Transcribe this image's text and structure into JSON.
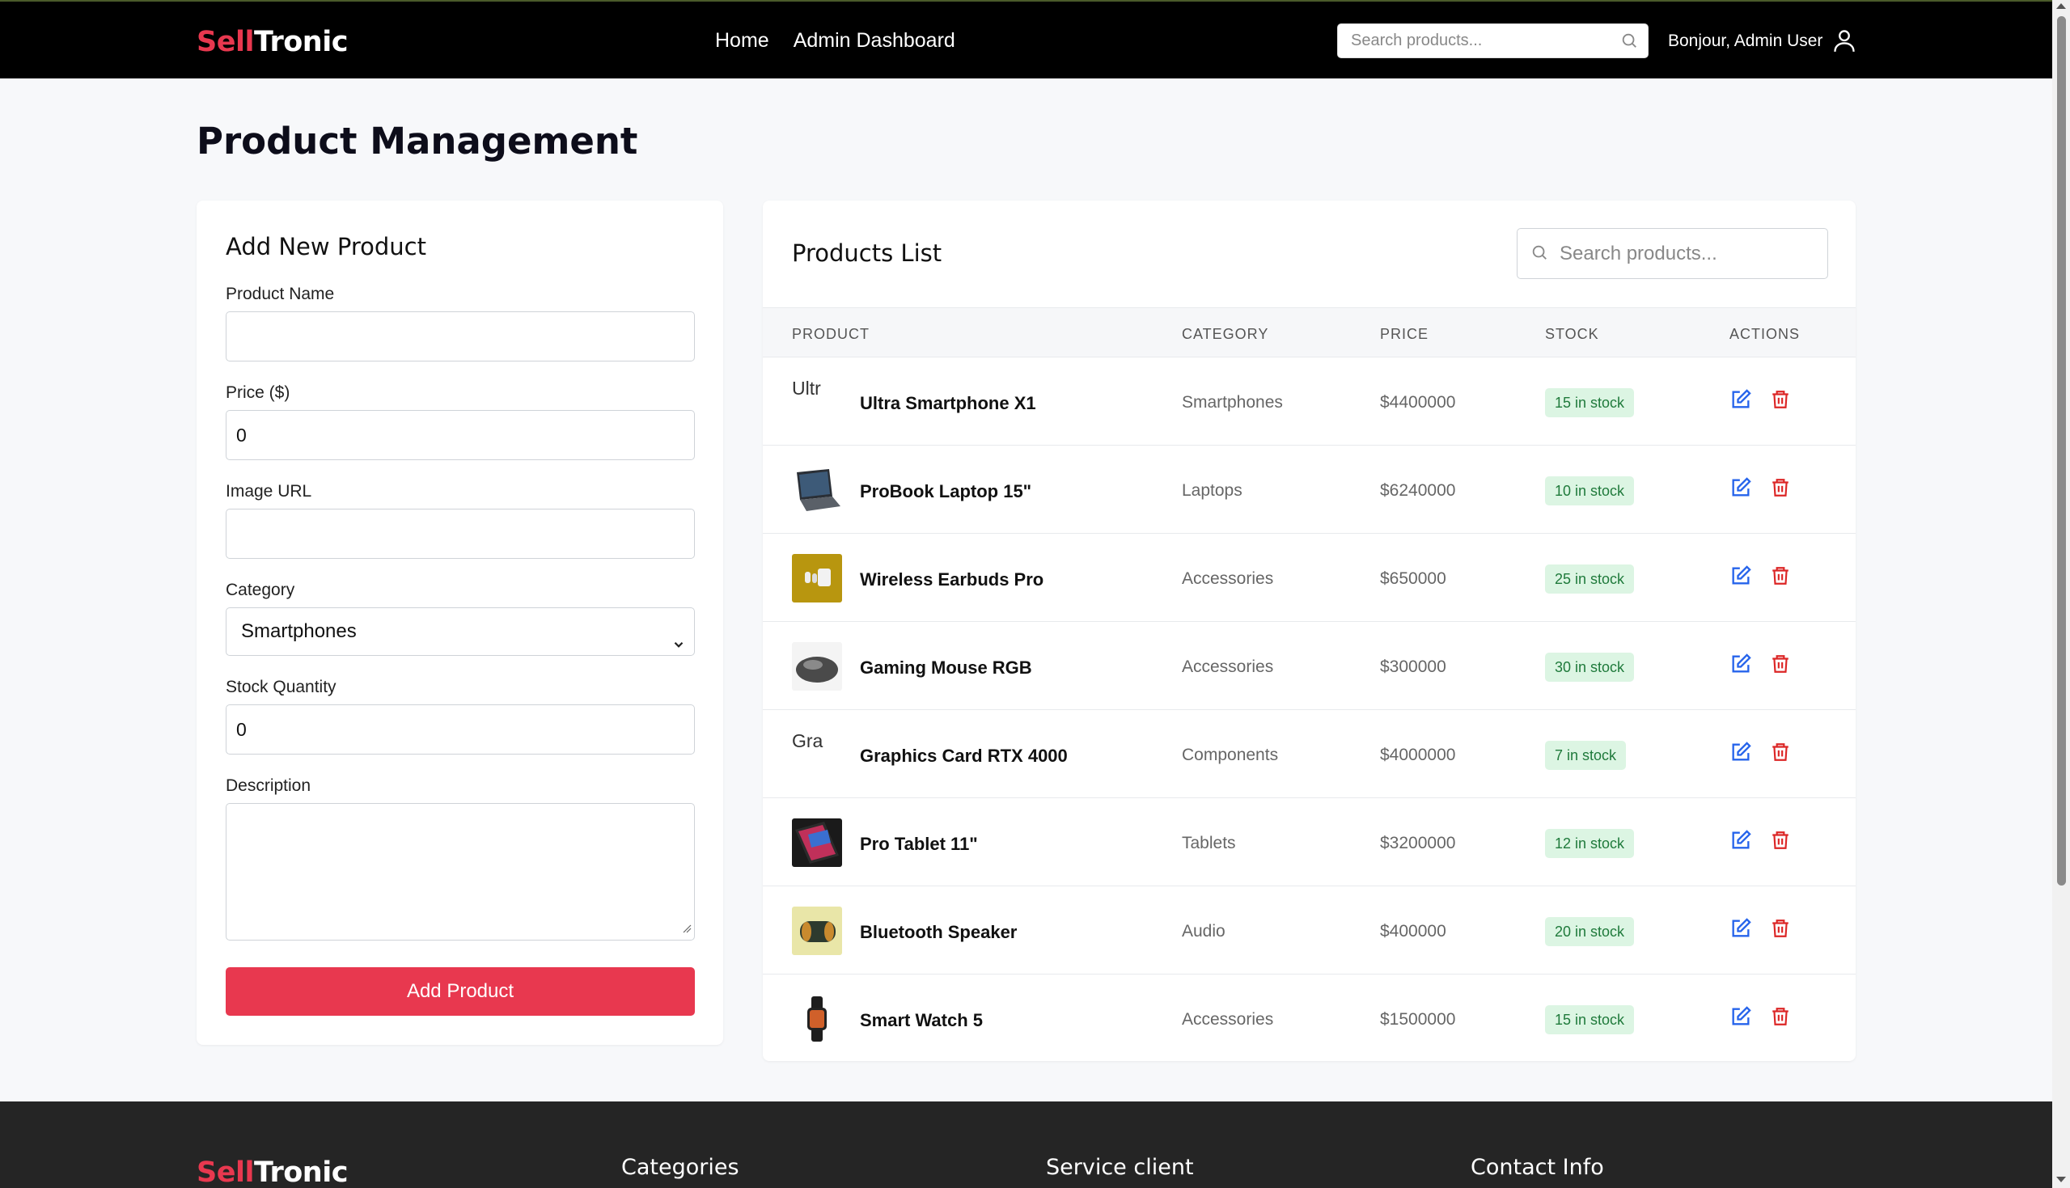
{
  "brand": {
    "part1": "Sell",
    "part2": "Tronic"
  },
  "nav": {
    "links": [
      "Home",
      "Admin Dashboard"
    ],
    "search_placeholder": "Search products...",
    "greeting": "Bonjour, Admin User"
  },
  "page": {
    "title": "Product Management"
  },
  "form": {
    "title": "Add New Product",
    "name_label": "Product Name",
    "name_value": "",
    "price_label": "Price ($)",
    "price_value": "0",
    "image_label": "Image URL",
    "image_value": "",
    "category_label": "Category",
    "category_value": "Smartphones",
    "stock_label": "Stock Quantity",
    "stock_value": "0",
    "description_label": "Description",
    "submit_label": "Add Product"
  },
  "list": {
    "title": "Products List",
    "search_placeholder": "Search products...",
    "headers": [
      "PRODUCT",
      "CATEGORY",
      "PRICE",
      "STOCK",
      "ACTIONS"
    ],
    "rows": [
      {
        "name": "Ultra Smartphone X1",
        "category": "Smartphones",
        "price": "$4400000",
        "stock": "15 in stock",
        "image_alt": "Ultr",
        "image": "broken"
      },
      {
        "name": "ProBook Laptop 15\"",
        "category": "Laptops",
        "price": "$6240000",
        "stock": "10 in stock",
        "image": "laptop"
      },
      {
        "name": "Wireless Earbuds Pro",
        "category": "Accessories",
        "price": "$650000",
        "stock": "25 in stock",
        "image": "earbuds"
      },
      {
        "name": "Gaming Mouse RGB",
        "category": "Accessories",
        "price": "$300000",
        "stock": "30 in stock",
        "image": "mouse"
      },
      {
        "name": "Graphics Card RTX 4000",
        "category": "Components",
        "price": "$4000000",
        "stock": "7 in stock",
        "image_alt": "Gra",
        "image": "broken"
      },
      {
        "name": "Pro Tablet 11\"",
        "category": "Tablets",
        "price": "$3200000",
        "stock": "12 in stock",
        "image": "tablet"
      },
      {
        "name": "Bluetooth Speaker",
        "category": "Audio",
        "price": "$400000",
        "stock": "20 in stock",
        "image": "speaker"
      },
      {
        "name": "Smart Watch 5",
        "category": "Accessories",
        "price": "$1500000",
        "stock": "15 in stock",
        "image": "watch"
      }
    ]
  },
  "footer": {
    "headings": [
      "Categories",
      "Service client",
      "Contact Info"
    ]
  },
  "colors": {
    "brand_red": "#e8384f",
    "nav_bg": "#000000",
    "badge_bg": "#dcf5e3",
    "badge_text": "#1f7a3b",
    "edit_blue": "#2563eb",
    "delete_red": "#dc2626"
  }
}
